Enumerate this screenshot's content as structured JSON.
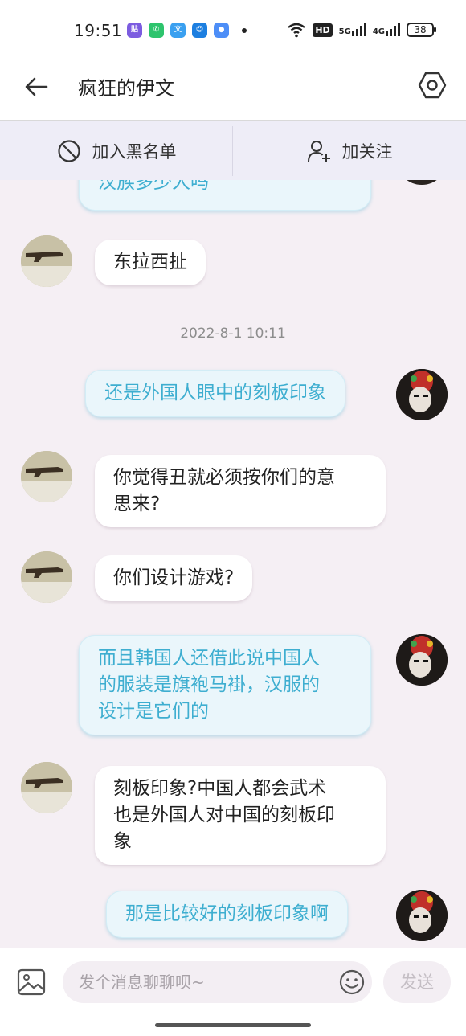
{
  "status_bar": {
    "time": "19:51",
    "icons": [
      "bluetooth-app-icon",
      "phone-app-icon",
      "translate-app-icon",
      "robot-app-icon",
      "message-app-icon"
    ],
    "network": [
      "5G",
      "4G"
    ],
    "hd_label": "HD",
    "battery": "38"
  },
  "header": {
    "title": "疯狂的伊文"
  },
  "actions": {
    "blacklist_label": "加入黑名单",
    "follow_label": "加关注"
  },
  "messages": [
    {
      "side": "out",
      "text": "汉族多少人吗"
    },
    {
      "side": "in",
      "text": "东拉西扯"
    },
    {
      "type": "time",
      "text": "2022-8-1 10:11"
    },
    {
      "side": "out",
      "text": "还是外国人眼中的刻板印象"
    },
    {
      "side": "in",
      "text": "你觉得丑就必须按你们的意\n思来?"
    },
    {
      "side": "in",
      "text": "你们设计游戏?"
    },
    {
      "side": "out",
      "text": "而且韩国人还借此说中国人\n的服装是旗袍马褂，汉服的\n设计是它们的"
    },
    {
      "side": "in",
      "text": "刻板印象?中国人都会武术\n也是外国人对中国的刻板印\n象"
    },
    {
      "side": "out",
      "text": "那是比较好的刻板印象啊"
    }
  ],
  "input_bar": {
    "placeholder": "发个消息聊聊呗~",
    "send_label": "发送"
  },
  "colors": {
    "outgoing_text": "#3eaed0",
    "outgoing_bg": "#eaf6fb",
    "chat_bg": "#f5eff4",
    "action_bar_bg": "#eeedf7"
  }
}
